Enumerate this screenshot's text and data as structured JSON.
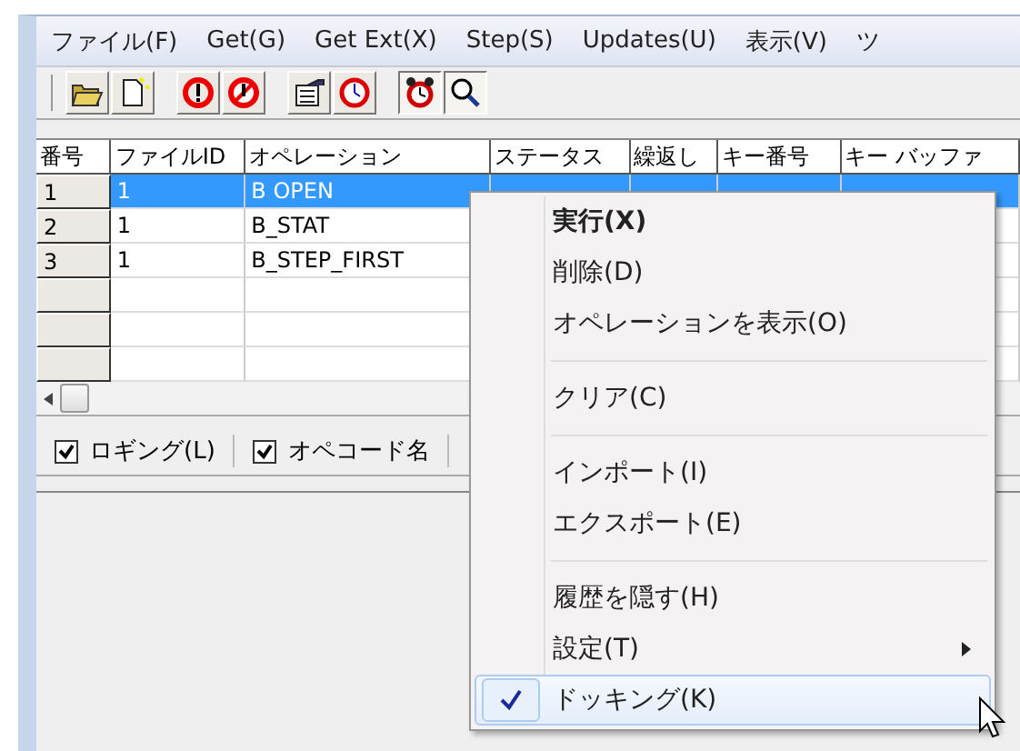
{
  "menu_bar": [
    "ファイル(F)",
    "Get(G)",
    "Get Ext(X)",
    "Step(S)",
    "Updates(U)",
    "表示(V)",
    "ツ"
  ],
  "toolbar": [
    {
      "kind": "open",
      "pressed": false
    },
    {
      "kind": "new",
      "pressed": false
    },
    {
      "kind": "sep"
    },
    {
      "kind": "run",
      "pressed": false
    },
    {
      "kind": "stop",
      "pressed": false
    },
    {
      "kind": "sep"
    },
    {
      "kind": "props",
      "pressed": false
    },
    {
      "kind": "clock",
      "pressed": false
    },
    {
      "kind": "sep"
    },
    {
      "kind": "alarm",
      "pressed": true
    },
    {
      "kind": "search",
      "pressed": true
    }
  ],
  "table": {
    "columns": [
      "番号",
      "ファイルID",
      "オペレーション",
      "ステータス",
      "繰返し",
      "キー番号",
      "キー バッファ"
    ],
    "rows": [
      {
        "selected": true,
        "cells": [
          "1",
          "1",
          "B OPEN"
        ]
      },
      {
        "selected": false,
        "cells": [
          "2",
          "1",
          "B_STAT"
        ]
      },
      {
        "selected": false,
        "cells": [
          "3",
          "1",
          "B_STEP_FIRST"
        ]
      },
      {
        "selected": false,
        "cells": []
      },
      {
        "selected": false,
        "cells": []
      },
      {
        "selected": false,
        "cells": []
      }
    ]
  },
  "options": [
    {
      "label": "ロギング(L)",
      "checked": true
    },
    {
      "label": "オペコード名",
      "checked": true
    }
  ],
  "context_menu": [
    {
      "kind": "item",
      "label": "実行(X)",
      "default": true
    },
    {
      "kind": "item",
      "label": "削除(D)"
    },
    {
      "kind": "item",
      "label": "オペレーションを表示(O)"
    },
    {
      "kind": "separator"
    },
    {
      "kind": "item",
      "label": "クリア(C)"
    },
    {
      "kind": "separator"
    },
    {
      "kind": "item",
      "label": "インポート(I)"
    },
    {
      "kind": "item",
      "label": "エクスポート(E)"
    },
    {
      "kind": "separator"
    },
    {
      "kind": "item",
      "label": "履歴を隠す(H)"
    },
    {
      "kind": "item",
      "label": "設定(T)",
      "submenu": true
    },
    {
      "kind": "item",
      "label": "ドッキング(K)",
      "checked": true,
      "selected": true
    }
  ]
}
